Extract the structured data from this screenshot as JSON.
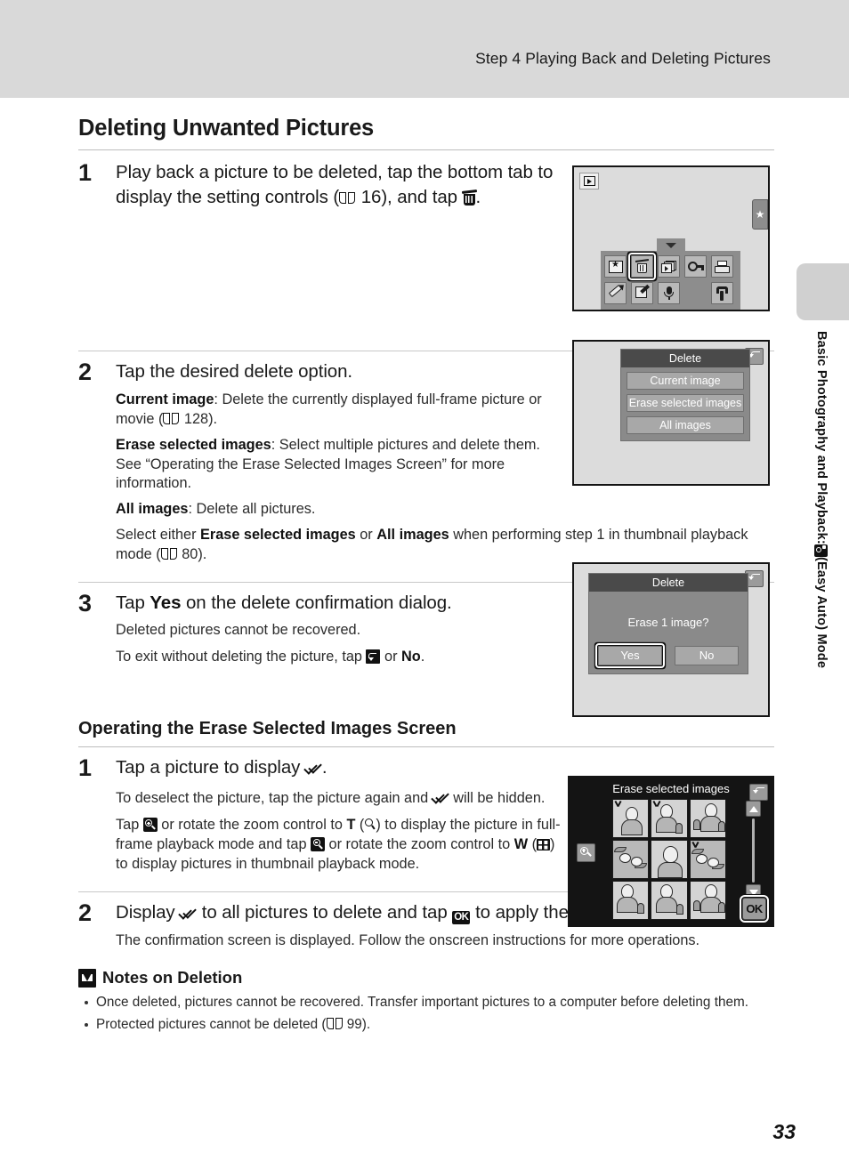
{
  "header": {
    "running_title": "Step 4 Playing Back and Deleting Pictures"
  },
  "side_tab": {
    "text_before_icon": "Basic Photography and Playback:",
    "icon": "easy-auto-mode-icon",
    "text_after_icon": "(Easy Auto) Mode"
  },
  "page": {
    "title": "Deleting Unwanted Pictures",
    "number": "33"
  },
  "steps": [
    {
      "number": "1",
      "heading_parts": {
        "a": "Play back a picture to be deleted, tap the bottom tab to display the setting controls (",
        "ref": "16",
        "b": "), and tap ",
        "c": "."
      }
    },
    {
      "number": "2",
      "heading": "Tap the desired delete option.",
      "paragraphs": [
        {
          "bold": "Current image",
          "text": ": Delete the currently displayed full-frame picture or movie (",
          "ref": "128",
          "tail": ")."
        },
        {
          "bold": "Erase selected images",
          "text": ": Select multiple pictures and delete them. See “Operating the Erase Selected Images Screen” for more information."
        },
        {
          "bold": "All images",
          "text": ": Delete all pictures."
        }
      ],
      "closing": {
        "a": "Select either ",
        "b1": "Erase selected images",
        "mid": " or ",
        "b2": "All images",
        "c": " when performing step 1 in thumbnail playback mode (",
        "ref": "80",
        "tail": ")."
      }
    },
    {
      "number": "3",
      "heading_parts": {
        "a": "Tap ",
        "bold": "Yes",
        "b": " on the delete confirmation dialog."
      },
      "sub1": "Deleted pictures cannot be recovered.",
      "sub2": {
        "a": "To exit without deleting the picture, tap ",
        "icon": "back-icon",
        "b": " or ",
        "bold": "No",
        "c": "."
      }
    }
  ],
  "subsection": {
    "title": "Operating the Erase Selected Images Screen",
    "steps": [
      {
        "number": "1",
        "heading_parts": {
          "a": "Tap a picture to display ",
          "icon": "check-icon",
          "b": "."
        },
        "sub1": {
          "a": "To deselect the picture, tap the picture again and ",
          "icon": "check-icon",
          "b": " will be hidden."
        },
        "sub2": {
          "a": "Tap ",
          "icon1": "zoom-in-icon",
          "b": " or rotate the zoom control to ",
          "t": "T",
          "c": " (",
          "icon2": "telephoto-icon",
          "d": ") to display the picture in full-frame playback mode and tap ",
          "icon3": "zoom-out-icon",
          "e": " or rotate the zoom control to ",
          "w": "W",
          "f": " (",
          "icon4": "wide-thumbnail-icon",
          "g": ") to display pictures in thumbnail playback mode."
        }
      },
      {
        "number": "2",
        "heading_parts": {
          "a": "Display ",
          "icon1": "check-icon",
          "b": " to all pictures to delete and tap ",
          "ok": "OK",
          "c": " to apply the selection."
        },
        "sub1": "The confirmation screen is displayed. Follow the onscreen instructions for more operations."
      }
    ]
  },
  "notes": {
    "title": "Notes on Deletion",
    "items": [
      {
        "text": "Once deleted, pictures cannot be recovered. Transfer important pictures to a computer before deleting them."
      },
      {
        "text": "Protected pictures cannot be deleted (",
        "ref": "99",
        "tail": ")."
      }
    ]
  },
  "screens": {
    "playback": {
      "name": "playback-mode-screen",
      "badge": "playback-icon",
      "side_tab": "favorites-star-tab",
      "controls_row1": [
        "favorite-pictures-icon",
        "delete-icon",
        "slide-show-icon",
        "protect-key-icon",
        "print-order-icon"
      ],
      "controls_row2": [
        "retouch-pencil-icon",
        "edit-image-icon",
        "voice-memo-icon",
        "setup-wrench-icon"
      ],
      "selected_control": "delete-icon"
    },
    "delete_menu": {
      "title": "Delete",
      "items": [
        "Current image",
        "Erase selected images",
        "All images"
      ],
      "back_button": "back-icon"
    },
    "confirm": {
      "title": "Delete",
      "message": "Erase 1 image?",
      "buttons": [
        "Yes",
        "No"
      ],
      "selected_button": "Yes",
      "back_button": "back-icon"
    },
    "erase_selected": {
      "title": "Erase selected images",
      "zoom_button": "zoom-in-icon",
      "back_button": "back-icon",
      "scroll_up": "scroll-up-arrow-icon",
      "scroll_down": "scroll-down-arrow-icon",
      "ok_button": "OK",
      "thumbnails": [
        {
          "kind": "person",
          "checked": true
        },
        {
          "kind": "person",
          "checked": true
        },
        {
          "kind": "person",
          "checked": false
        },
        {
          "kind": "flower",
          "checked": false
        },
        {
          "kind": "person",
          "checked": false
        },
        {
          "kind": "flower",
          "checked": true
        },
        {
          "kind": "person",
          "checked": false
        },
        {
          "kind": "person",
          "checked": false
        },
        {
          "kind": "person",
          "checked": false
        }
      ]
    }
  }
}
